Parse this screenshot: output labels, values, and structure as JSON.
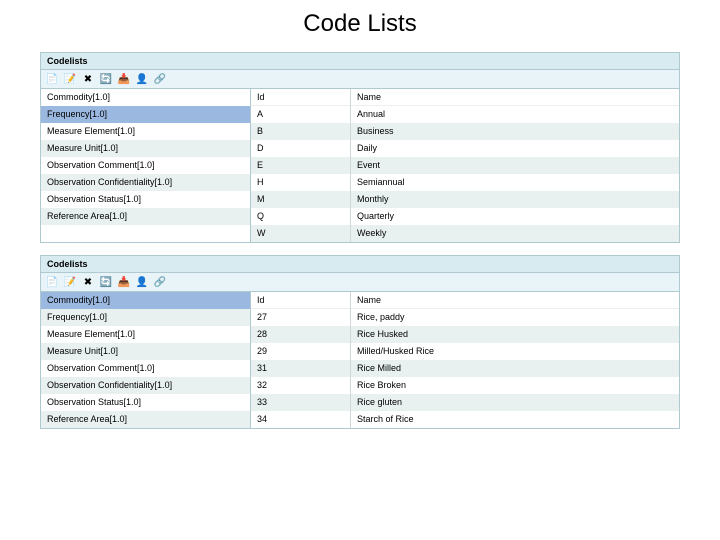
{
  "title": "Code Lists",
  "panel_label": "Codelists",
  "toolbar_icons": [
    {
      "name": "new-icon",
      "glyph": "📄"
    },
    {
      "name": "edit-icon",
      "glyph": "📝"
    },
    {
      "name": "delete-icon",
      "glyph": "✖"
    },
    {
      "name": "refresh-icon",
      "glyph": "🔄"
    },
    {
      "name": "import-icon",
      "glyph": "📥"
    },
    {
      "name": "user-icon",
      "glyph": "👤"
    },
    {
      "name": "link-icon",
      "glyph": "🔗"
    }
  ],
  "codelists": [
    "Commodity[1.0]",
    "Frequency[1.0]",
    "Measure Element[1.0]",
    "Measure Unit[1.0]",
    "Observation Comment[1.0]",
    "Observation Confidentiality[1.0]",
    "Observation Status[1.0]",
    "Reference Area[1.0]"
  ],
  "columns": {
    "id": "Id",
    "name": "Name"
  },
  "panel1": {
    "selected_index": 1,
    "rows": [
      {
        "id": "A",
        "name": "Annual"
      },
      {
        "id": "B",
        "name": "Business"
      },
      {
        "id": "D",
        "name": "Daily"
      },
      {
        "id": "E",
        "name": "Event"
      },
      {
        "id": "H",
        "name": "Semiannual"
      },
      {
        "id": "M",
        "name": "Monthly"
      },
      {
        "id": "Q",
        "name": "Quarterly"
      },
      {
        "id": "W",
        "name": "Weekly"
      }
    ]
  },
  "panel2": {
    "selected_index": 0,
    "rows": [
      {
        "id": "27",
        "name": "Rice, paddy"
      },
      {
        "id": "28",
        "name": "Rice Husked"
      },
      {
        "id": "29",
        "name": "Milled/Husked Rice"
      },
      {
        "id": "31",
        "name": "Rice Milled"
      },
      {
        "id": "32",
        "name": "Rice Broken"
      },
      {
        "id": "33",
        "name": "Rice gluten"
      },
      {
        "id": "34",
        "name": "Starch of Rice"
      }
    ]
  }
}
